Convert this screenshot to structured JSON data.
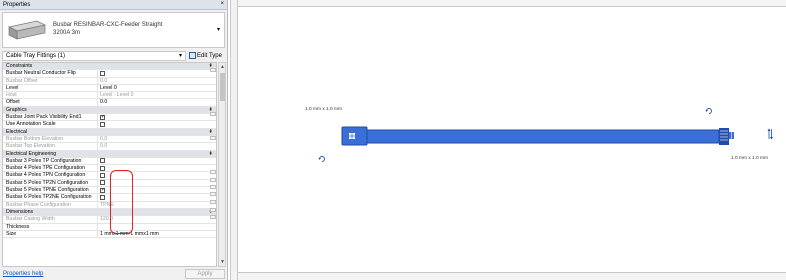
{
  "panel": {
    "title": "Properties",
    "close_glyph": "×",
    "type_name": "Busbar RESINBAR-CXC-Feeder Straight",
    "type_size": "3200A 3m",
    "dropdown_glyph": "▾",
    "filter_label": "Cable Tray Fittings (1)",
    "edit_type_label": "Edit Type",
    "help_link": "Properties help",
    "apply_label": "Apply"
  },
  "rows": [
    {
      "kind": "section",
      "label": "Constraints",
      "toggle": "⇞"
    },
    {
      "kind": "prop",
      "label": "Busbar Neutral Conductor Flip",
      "value": "",
      "checkbox": "unchecked",
      "dim": false
    },
    {
      "kind": "prop",
      "label": "Busbar Offset",
      "value": "0.0",
      "dim": true
    },
    {
      "kind": "prop",
      "label": "Level",
      "value": "Level 0",
      "dim": false
    },
    {
      "kind": "prop",
      "label": "Host",
      "value": "Level : Level 0",
      "dim": true
    },
    {
      "kind": "prop",
      "label": "Offset",
      "value": "0.0",
      "dim": false
    },
    {
      "kind": "section",
      "label": "Graphics",
      "toggle": "⇞"
    },
    {
      "kind": "prop",
      "label": "Busbar Joint Pack Visibility End1",
      "value": "",
      "checkbox": "checked",
      "dim": false
    },
    {
      "kind": "prop",
      "label": "Use Annotation Scale",
      "value": "",
      "checkbox": "unchecked",
      "dim": false
    },
    {
      "kind": "section",
      "label": "Electrical",
      "toggle": "⇞"
    },
    {
      "kind": "prop",
      "label": "Busbar Bottom Elevation",
      "value": "0.0",
      "dim": true
    },
    {
      "kind": "prop",
      "label": "Busbar Top Elevation",
      "value": "0.0",
      "dim": true
    },
    {
      "kind": "section",
      "label": "Electrical Engineering",
      "toggle": "⇞"
    },
    {
      "kind": "prop",
      "label": "Busbar 3 Poles TP Configuration",
      "value": "",
      "checkbox": "unchecked",
      "dim": false
    },
    {
      "kind": "prop",
      "label": "Busbar 4 Poles TPE Configuration",
      "value": "",
      "checkbox": "unchecked",
      "dim": false
    },
    {
      "kind": "prop",
      "label": "Busbar 4 Poles TPN Configuration",
      "value": "",
      "checkbox": "unchecked",
      "dim": false
    },
    {
      "kind": "prop",
      "label": "Busbar 5 Poles TP2N Configuration",
      "value": "",
      "checkbox": "unchecked",
      "dim": false
    },
    {
      "kind": "prop",
      "label": "Busbar 5 Poles TPNE Configuration",
      "value": "",
      "checkbox": "checked",
      "dim": false
    },
    {
      "kind": "prop",
      "label": "Busbar 6 Poles TP2NE Configuration",
      "value": "",
      "checkbox": "unchecked",
      "dim": false
    },
    {
      "kind": "prop",
      "label": "Busbar Phase Configuration",
      "value": "TPNE",
      "dim": true
    },
    {
      "kind": "section",
      "label": "Dimensions",
      "toggle": "⇞"
    },
    {
      "kind": "prop",
      "label": "Busbar Casing Width",
      "value": "120.0",
      "dim": true
    },
    {
      "kind": "prop",
      "label": "Thickness",
      "value": "",
      "dim": false
    },
    {
      "kind": "prop",
      "label": "Size",
      "value": "1 mmx1 mm-1 mmx1 mm",
      "dim": false
    }
  ],
  "canvas": {
    "dim_left": "1.0 mm x 1.0 mm",
    "dim_right": "1.0 mm x 1.0 mm",
    "busbar_color": "#3a6fd8",
    "busbar_edge_color": "#1f4ea8",
    "rotate_icon": "rotate-icon",
    "flip_icon": "flip-arrows-icon"
  }
}
